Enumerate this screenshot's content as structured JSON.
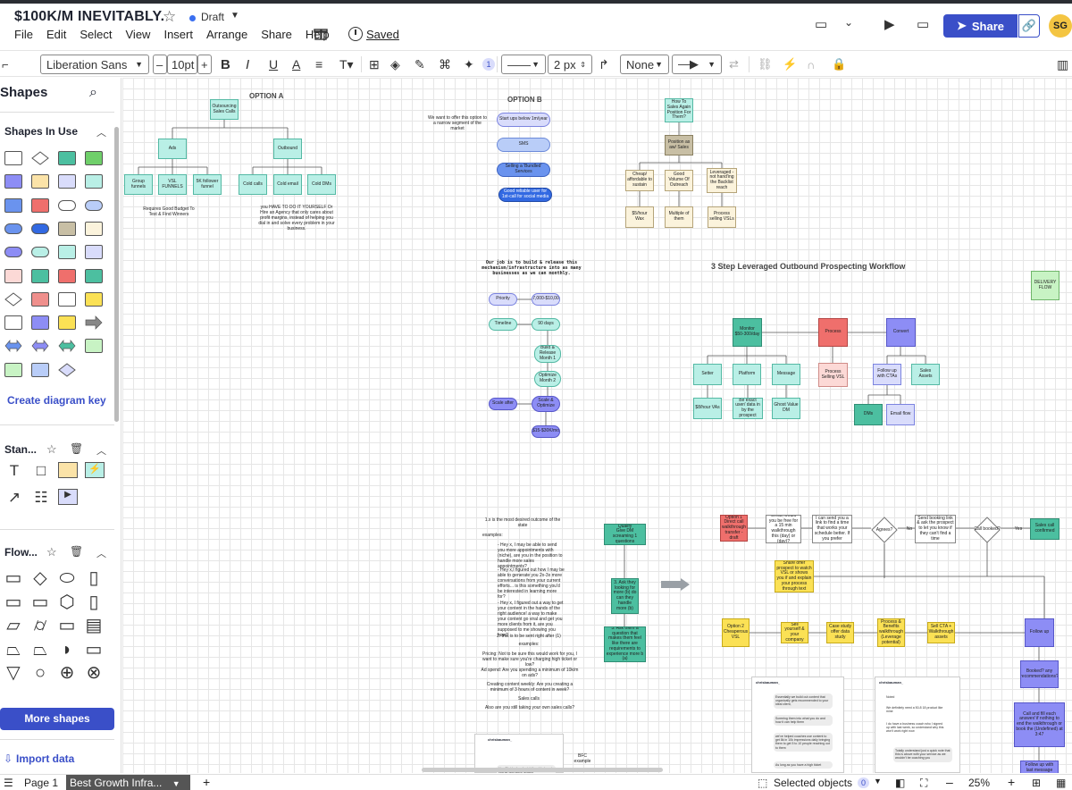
{
  "header": {
    "title": "$100K/M INEVITABLY.",
    "status": "Draft",
    "menu": [
      "File",
      "Edit",
      "Select",
      "View",
      "Insert",
      "Arrange",
      "Share",
      "Help"
    ],
    "saved": "Saved",
    "share_label": "Share",
    "avatar": "SG"
  },
  "toolbar": {
    "font": "Liberation Sans",
    "font_size": "10pt",
    "minus": "–",
    "plus": "+",
    "bold": "B",
    "italic": "I",
    "underline": "U",
    "text_color": "A",
    "badge": "1",
    "line_width": "2 px",
    "line_end": "None"
  },
  "left_panel": {
    "title": "Shapes",
    "in_use": "Shapes In Use",
    "create_key": "Create diagram key",
    "standard": "Stan...",
    "flow": "Flow...",
    "more_shapes": "More shapes",
    "import": "Import data"
  },
  "canvas": {
    "option_a": "OPTION A",
    "option_b": "OPTION B",
    "workflow_title": "3 Step Leveraged Outbound Prospecting Workflow",
    "mission": "Our job is to build & release this mechanism/infrastructure into as many businesses as we can monthly.",
    "a_root": "Outsourcing Sales Calls",
    "a_ads": "Ads",
    "a_outbound": "Outbound",
    "a_group": "Group funnels",
    "a_vsl": "VSL FUNNELS",
    "a_5k": "5K follower funnel",
    "a_cold_calls": "Cold calls",
    "a_cold_email": "Cold email",
    "a_cold_dms": "Cold DMs",
    "a_note_left": "Requires Good Budget To Test & Find Winners",
    "a_note_right": "you HAVE TO DO IT YOURSELF Or Hire an Agency that only cares about profit margins, instead of helping you dial in and solve every problem in your business.",
    "b_note": "We want to offer this option to a narrow segment of the market",
    "b1": "Start ups below 1m/year",
    "b2": "SMS",
    "b3": "Selling a 'Bundled' Services",
    "b4": "Good reliable user for 1st-call for social media",
    "r_top": "How To Sales Again Position For Them?",
    "r_mid": "Position as aw/ Sales",
    "r_c1": "Cheap/ affordable to sustain",
    "r_c2": "Good Volume Of Outreach",
    "r_c3": "Leveraged - not hand'ing the Backlist reach",
    "r_d1": "$5/hour Wax",
    "r_d2": "Multiple of them",
    "r_d3": "Process selling VSLs",
    "m_priority": "Priority",
    "m_priority_val": "$7,000-$10,000",
    "m_timeline": "Timeline",
    "m_timeline_val": "90 days",
    "m_build": "Build & Release Month 1",
    "m_optimize": "Optimize Month 2",
    "m_scale": "Scale & Optimize",
    "m_scale_l": "Scale after",
    "m_bottom": "$15-$30K/mo",
    "w_top": "Monitor",
    "w_top_sub": "$50-300/day",
    "w_proc": "Process",
    "w_convert": "Convert",
    "w_setter": "Setter",
    "w_platform": "Platform",
    "w_message": "Message",
    "w_hour": "$8/hour VAs",
    "w_exact": "Be exact user/ data in by the prospect",
    "w_ghost": "Ghost Value DM",
    "w_process_vsl": "Process Selling VSL",
    "w_followup": "Follow up with CTAs",
    "w_sales": "Sales Assets",
    "w_dms": "DMs",
    "w_email": "Email flow",
    "w_delivery": "DELIVERY FLOW",
    "q_heading": "1.x is the most desired outcome of the state",
    "q_examples": "examples:",
    "q_body1": "- Hey x, I may be able to send you more appointments with (niche), are you in the position to handle more sales appointments?",
    "q_body2": "- Hey x,I figured out how I may be able to generate you 2x-3x more conversations from your current efforts... is this something you'd be interested in learning more for?",
    "q_body3": "- Hey x, I figured out a way to get your content in the hands of the right audience! a way to make your content go viral and get you more clients from it, are you supposed to me showing you how?",
    "q_note1": "2. this is to be sent right after (1)",
    "q_examples2": "examples:",
    "q_pricing": "Pricing: Not to be sure this would work for you, I want to make sure you're charging high ticket or low?",
    "q_ad": "Ad spend: Are you spending a minimum of 10k/m on ads?",
    "q_content": "Creating content weekly: Are you creating a minimum of 3 hours of content in week?",
    "q_sales": "Sales calls",
    "q_sales2": "Also are you still taking your own sales calls?",
    "qual_title": "Qualify",
    "qual_sub": "Give DM screaming 1 questions",
    "qual_ask": "3. Ask they looking for more (b) do can they handle more (b)",
    "qual_ask2": "3. Ask them a question that makes them feel like there are requirements to experience more b (a)",
    "f_opt": "Option 1",
    "f_opt_sub": "Direct call walkthrough transfer - draft",
    "f_q1": "Great, would you be free for a 15 min walkthrough this (day) or (day)?",
    "f_q2": "I can send you a link to find a time that works your schedule better. If you prefer",
    "f_agree": "Agrees?",
    "f_send": "Send booking link & ask the prospect to let you know if they can't find a time",
    "f_call": "Call booked?",
    "f_sales": "Sales call confirmed",
    "f_share": "Share offer prospect to watch VSL or shows you if and explain your process through text",
    "f_opt2": "Option 2",
    "f_opt2_sub": "Cheaperous VSL",
    "f_sell": "Sell yourself & your company",
    "f_case": "Case study offer data study",
    "f_process": "Process & Benefits walkthrough (Leverage potential)",
    "f_cta": "Sell CTA + Walkthrough assets",
    "f_follow": "Follow up",
    "f_booked": "Booked? any recommendations?",
    "f_call2": "Call and fill each answer/ if nothing to end the walkthrough or book the (Undefined) at 3:47",
    "f_follow2": "Follow up with last message",
    "f_yes": "Yes",
    "f_no": "No",
    "phone_name": "chrisbauman_",
    "phone_msg1": "Essentially we build out content that organically gets recommended to your ideal client,",
    "phone_msg2": "Screeing them into what you do and how it can help them",
    "phone_msg3": "we've helped coaches use content to get 8k in 10k impressions daily bringing them to get 5 to 10 people reaching out to them",
    "phone_msg4": "As long as you have a high ticket",
    "phone2_msg1": "Noted",
    "phone2_msg2": "We definitely need a 50-8 18 product like mine",
    "phone2_msg3": "I do have a business coach who I signed up with last week, so understand why this won't work right now",
    "phone2_msg4": "Totally understand just a quick note that this is above with your service as we wouldn't be coaching you",
    "bfc": "BFC example",
    "phone3_msg": "Hey Christopher, I might be able to get you up with some groups"
  },
  "bottom": {
    "page": "Page 1",
    "tab": "Best Growth Infra...",
    "selected": "Selected objects",
    "selected_count": "0",
    "zoom": "25%",
    "add": "+",
    "minus": "–",
    "plus": "+"
  },
  "colors": {
    "accent": "#3a4fc8",
    "teal": "#b9efe6",
    "green": "#4cbfa0",
    "red": "#ef6f6c",
    "violet": "#8d8df5",
    "yellow": "#fbe155"
  }
}
